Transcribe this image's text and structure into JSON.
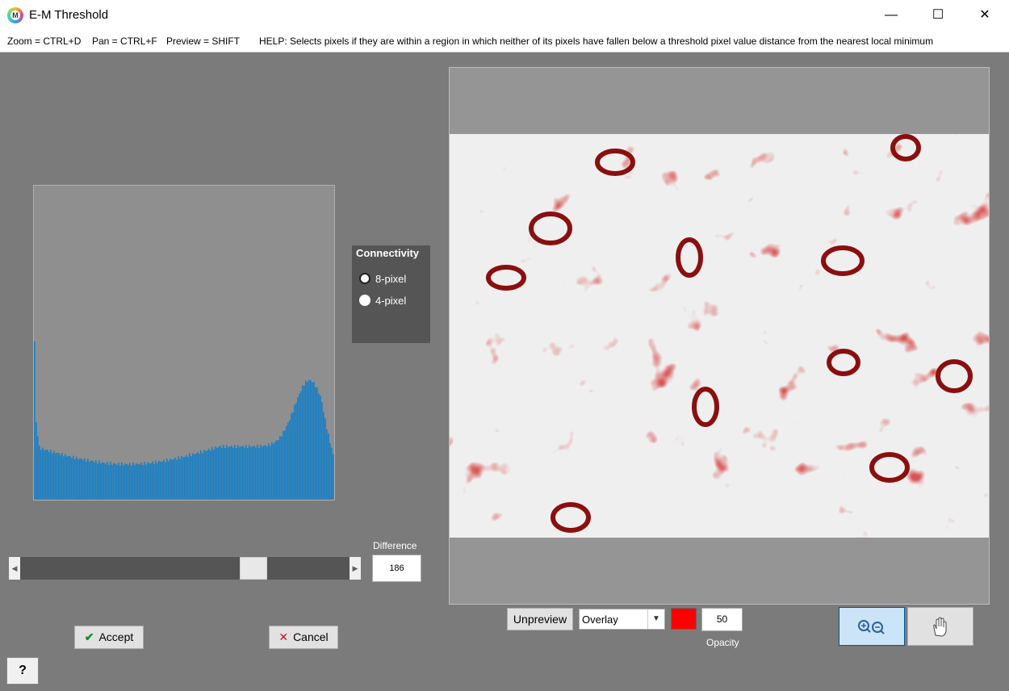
{
  "window": {
    "title": "E-M Threshold",
    "app_icon_letter": "M",
    "minimize": "—",
    "maximize": "☐",
    "close": "✕"
  },
  "shortcuts": {
    "zoom": "Zoom = CTRL+D",
    "pan": "Pan = CTRL+F",
    "preview": "Preview = SHIFT",
    "help": "HELP:  Selects pixels if they are within a region in which neither of its pixels have fallen below a threshold pixel value distance from the nearest local minimum"
  },
  "connectivity": {
    "title": "Connectivity",
    "options": [
      {
        "label": "8-pixel",
        "selected": true
      },
      {
        "label": "4-pixel",
        "selected": false
      }
    ]
  },
  "difference": {
    "label": "Difference",
    "value": "186",
    "slider_fraction": 0.73
  },
  "buttons": {
    "accept": "Accept",
    "cancel": "Cancel",
    "help": "?",
    "unpreview": "Unpreview"
  },
  "preview_controls": {
    "mode": "Overlay",
    "overlay_color": "#ff0000",
    "opacity_value": "50",
    "opacity_label": "Opacity"
  },
  "colors": {
    "histogram_bar": "#1a7fc4",
    "overlay_red": "#b01818",
    "panel_bg": "#7b7b7b"
  }
}
